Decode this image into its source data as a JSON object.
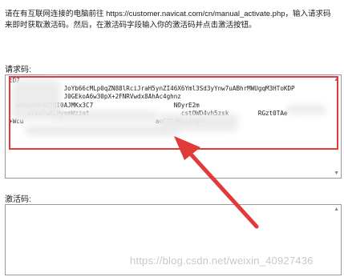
{
  "instructions": "请在有互联网连接的电脑前往 https://customer.navicat.com/cn/manual_activate.php，输入请求码来即时获取激活码。然后，在激活码字段输入你的激活码并点击激活按钮。",
  "request_code": {
    "label": "请求码:",
    "lines": [
      "tD7",
      "               JoYb66cMLp0qZN88lRciJraH5ynZI46X6Yml3Sd3yYnw7uABhrMWUgqM3HToKDP",
      "               J0GEkoA6w30pX+2FNRVwdx8AhAc4ghnz",
      "  mEeakObm0JQI0AJMKx3C7                      NOyrE2m",
      "     4YVxruRLHysmWzzat                         cstOWD4vh5zsk        RGzt0TAe",
      "+Wcu                                    aoC22dWaiqVg=="
    ]
  },
  "activation_code": {
    "label": "激活码:",
    "value": ""
  },
  "scroll_up_glyph": "▲",
  "scroll_down_glyph": "▼",
  "watermark": "https://blog.csdn.net/weixin_40927436",
  "colors": {
    "highlight": "#e03a3a",
    "arrow": "#e03a3a",
    "border": "#9a9a9a"
  }
}
